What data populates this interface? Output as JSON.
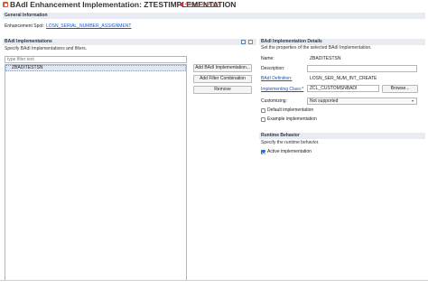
{
  "window": {
    "title": "BAdI Enhancement Implementation: ZTESTIMPLEMENTATION",
    "error_text": "4 errors detected"
  },
  "general": {
    "header": "General Information",
    "spot_label": "Enhancement Spot:",
    "spot_value": "LOSN_SERIAL_NUMBER_ASSIGNMENT"
  },
  "implementations": {
    "header": "BAdI Implementations",
    "description": "Specify BAdI Implementations and filters.",
    "filter_placeholder": "type filter text",
    "items": [
      "ZBADITESTSN"
    ],
    "buttons": {
      "add": "Add BAdI Implementation...",
      "add_filter": "Add Filter Combination",
      "remove": "Remove"
    }
  },
  "details": {
    "header": "BAdI Implementation Details",
    "description": "Set the properties of the selected BAdI Implementation.",
    "name_label": "Name:",
    "name_value": "ZBADITESTSN",
    "description_label": "Description:",
    "description_value": "",
    "badi_def_label": "BAdI Definition:",
    "badi_def_value": "LOSN_SER_NUM_INT_CREATE",
    "impl_class_label": "Implementing Class:*",
    "impl_class_value": "ZCL_CUSTOMSNBADI",
    "browse_label": "Browse...",
    "customizing_label": "Customizing:",
    "customizing_value": "Not supported",
    "default_impl_label": "Default implementation",
    "example_impl_label": "Example implementation",
    "default_impl_checked": false,
    "example_impl_checked": false
  },
  "runtime": {
    "header": "Runtime Behavior",
    "description": "Specify the runtime behavior.",
    "active_label": "Active implementation",
    "active_checked": true
  },
  "colors": {
    "accent": "#2f6dd0",
    "link": "#1a56c4",
    "error": "#c0392b",
    "section_bg": "#e8ecf2"
  }
}
